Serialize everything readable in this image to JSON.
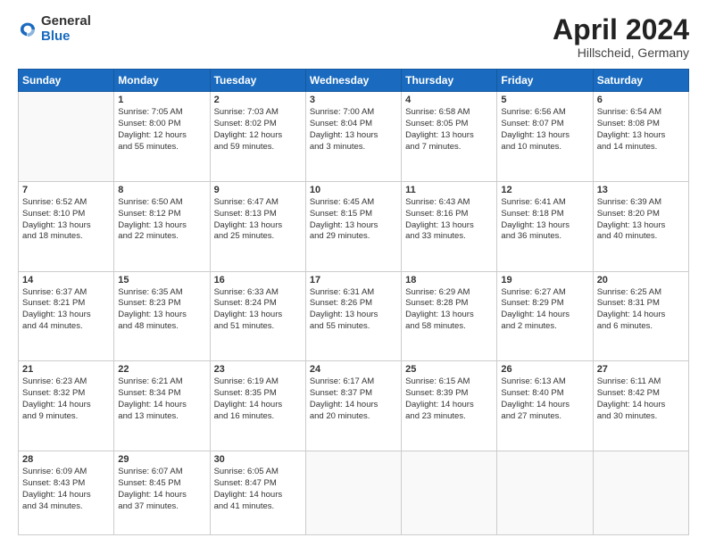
{
  "header": {
    "logo_general": "General",
    "logo_blue": "Blue",
    "month_title": "April 2024",
    "subtitle": "Hillscheid, Germany"
  },
  "weekdays": [
    "Sunday",
    "Monday",
    "Tuesday",
    "Wednesday",
    "Thursday",
    "Friday",
    "Saturday"
  ],
  "weeks": [
    [
      {
        "day": "",
        "info": ""
      },
      {
        "day": "1",
        "info": "Sunrise: 7:05 AM\nSunset: 8:00 PM\nDaylight: 12 hours\nand 55 minutes."
      },
      {
        "day": "2",
        "info": "Sunrise: 7:03 AM\nSunset: 8:02 PM\nDaylight: 12 hours\nand 59 minutes."
      },
      {
        "day": "3",
        "info": "Sunrise: 7:00 AM\nSunset: 8:04 PM\nDaylight: 13 hours\nand 3 minutes."
      },
      {
        "day": "4",
        "info": "Sunrise: 6:58 AM\nSunset: 8:05 PM\nDaylight: 13 hours\nand 7 minutes."
      },
      {
        "day": "5",
        "info": "Sunrise: 6:56 AM\nSunset: 8:07 PM\nDaylight: 13 hours\nand 10 minutes."
      },
      {
        "day": "6",
        "info": "Sunrise: 6:54 AM\nSunset: 8:08 PM\nDaylight: 13 hours\nand 14 minutes."
      }
    ],
    [
      {
        "day": "7",
        "info": "Sunrise: 6:52 AM\nSunset: 8:10 PM\nDaylight: 13 hours\nand 18 minutes."
      },
      {
        "day": "8",
        "info": "Sunrise: 6:50 AM\nSunset: 8:12 PM\nDaylight: 13 hours\nand 22 minutes."
      },
      {
        "day": "9",
        "info": "Sunrise: 6:47 AM\nSunset: 8:13 PM\nDaylight: 13 hours\nand 25 minutes."
      },
      {
        "day": "10",
        "info": "Sunrise: 6:45 AM\nSunset: 8:15 PM\nDaylight: 13 hours\nand 29 minutes."
      },
      {
        "day": "11",
        "info": "Sunrise: 6:43 AM\nSunset: 8:16 PM\nDaylight: 13 hours\nand 33 minutes."
      },
      {
        "day": "12",
        "info": "Sunrise: 6:41 AM\nSunset: 8:18 PM\nDaylight: 13 hours\nand 36 minutes."
      },
      {
        "day": "13",
        "info": "Sunrise: 6:39 AM\nSunset: 8:20 PM\nDaylight: 13 hours\nand 40 minutes."
      }
    ],
    [
      {
        "day": "14",
        "info": "Sunrise: 6:37 AM\nSunset: 8:21 PM\nDaylight: 13 hours\nand 44 minutes."
      },
      {
        "day": "15",
        "info": "Sunrise: 6:35 AM\nSunset: 8:23 PM\nDaylight: 13 hours\nand 48 minutes."
      },
      {
        "day": "16",
        "info": "Sunrise: 6:33 AM\nSunset: 8:24 PM\nDaylight: 13 hours\nand 51 minutes."
      },
      {
        "day": "17",
        "info": "Sunrise: 6:31 AM\nSunset: 8:26 PM\nDaylight: 13 hours\nand 55 minutes."
      },
      {
        "day": "18",
        "info": "Sunrise: 6:29 AM\nSunset: 8:28 PM\nDaylight: 13 hours\nand 58 minutes."
      },
      {
        "day": "19",
        "info": "Sunrise: 6:27 AM\nSunset: 8:29 PM\nDaylight: 14 hours\nand 2 minutes."
      },
      {
        "day": "20",
        "info": "Sunrise: 6:25 AM\nSunset: 8:31 PM\nDaylight: 14 hours\nand 6 minutes."
      }
    ],
    [
      {
        "day": "21",
        "info": "Sunrise: 6:23 AM\nSunset: 8:32 PM\nDaylight: 14 hours\nand 9 minutes."
      },
      {
        "day": "22",
        "info": "Sunrise: 6:21 AM\nSunset: 8:34 PM\nDaylight: 14 hours\nand 13 minutes."
      },
      {
        "day": "23",
        "info": "Sunrise: 6:19 AM\nSunset: 8:35 PM\nDaylight: 14 hours\nand 16 minutes."
      },
      {
        "day": "24",
        "info": "Sunrise: 6:17 AM\nSunset: 8:37 PM\nDaylight: 14 hours\nand 20 minutes."
      },
      {
        "day": "25",
        "info": "Sunrise: 6:15 AM\nSunset: 8:39 PM\nDaylight: 14 hours\nand 23 minutes."
      },
      {
        "day": "26",
        "info": "Sunrise: 6:13 AM\nSunset: 8:40 PM\nDaylight: 14 hours\nand 27 minutes."
      },
      {
        "day": "27",
        "info": "Sunrise: 6:11 AM\nSunset: 8:42 PM\nDaylight: 14 hours\nand 30 minutes."
      }
    ],
    [
      {
        "day": "28",
        "info": "Sunrise: 6:09 AM\nSunset: 8:43 PM\nDaylight: 14 hours\nand 34 minutes."
      },
      {
        "day": "29",
        "info": "Sunrise: 6:07 AM\nSunset: 8:45 PM\nDaylight: 14 hours\nand 37 minutes."
      },
      {
        "day": "30",
        "info": "Sunrise: 6:05 AM\nSunset: 8:47 PM\nDaylight: 14 hours\nand 41 minutes."
      },
      {
        "day": "",
        "info": ""
      },
      {
        "day": "",
        "info": ""
      },
      {
        "day": "",
        "info": ""
      },
      {
        "day": "",
        "info": ""
      }
    ]
  ]
}
